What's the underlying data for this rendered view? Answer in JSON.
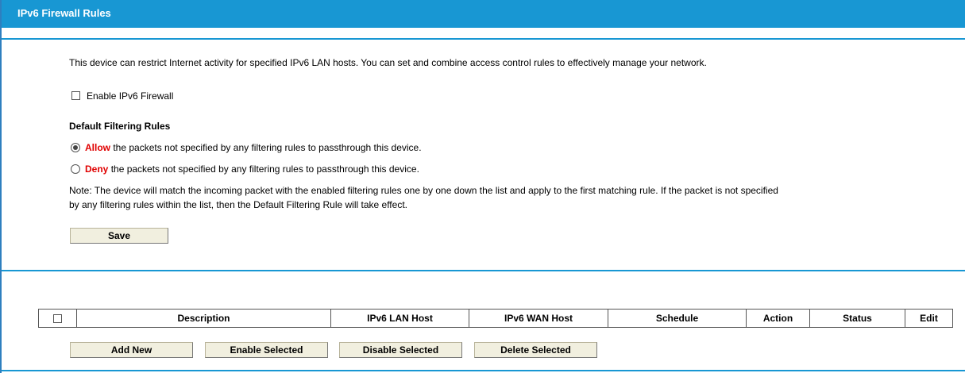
{
  "header": {
    "title": "IPv6 Firewall Rules"
  },
  "intro": "This device can restrict Internet activity for specified IPv6 LAN hosts. You can set and combine access control rules to effectively manage your network.",
  "enable_label": "Enable IPv6 Firewall",
  "default_rules": {
    "heading": "Default Filtering Rules",
    "allow_word": "Allow",
    "allow_text": "the packets not specified by any filtering rules to passthrough this device.",
    "deny_word": "Deny",
    "deny_text": "the packets not specified by any filtering rules to passthrough this device.",
    "selected": "allow"
  },
  "note_line1": "Note: The device will match the incoming packet with the enabled filtering rules one by one down the list and apply to the first matching rule. If the packet is not specified",
  "note_line2": "by any filtering rules within the list, then the Default Filtering Rule will take effect.",
  "save_label": "Save",
  "table": {
    "columns": [
      "Description",
      "IPv6 LAN Host",
      "IPv6 WAN Host",
      "Schedule",
      "Action",
      "Status",
      "Edit"
    ]
  },
  "actions": {
    "add_new": "Add New",
    "enable_selected": "Enable Selected",
    "disable_selected": "Disable Selected",
    "delete_selected": "Delete Selected"
  },
  "colors": {
    "accent": "#1897d3",
    "highlight": "#e00000",
    "button_bg": "#f1efdf"
  }
}
